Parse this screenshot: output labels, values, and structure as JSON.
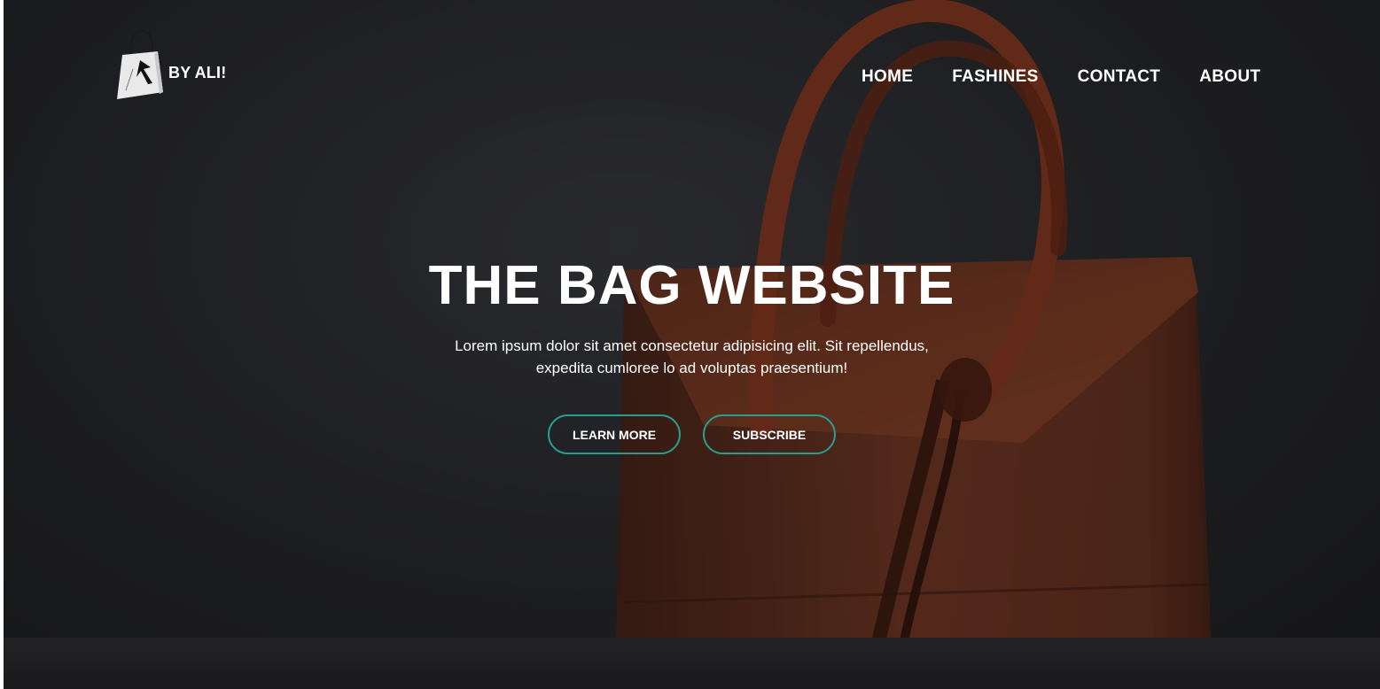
{
  "header": {
    "logo_text": "BY ALI!",
    "nav": [
      {
        "label": "HOME"
      },
      {
        "label": "FASHINES"
      },
      {
        "label": "CONTACT"
      },
      {
        "label": "ABOUT"
      }
    ]
  },
  "hero": {
    "title": "THE BAG WEBSITE",
    "description": "Lorem ipsum dolor sit amet consectetur adipisicing elit. Sit repellendus, expedita cumloree lo ad voluptas praesentium!",
    "buttons": {
      "learn_more": "LEARN MORE",
      "subscribe": "SUBSCRIBE"
    }
  },
  "icons": {
    "logo": "shopping-bag-icon"
  },
  "colors": {
    "background": "#2b2c30",
    "text": "#ffffff",
    "button_border": "#2a9d8f",
    "bag": "#8a3f26"
  }
}
